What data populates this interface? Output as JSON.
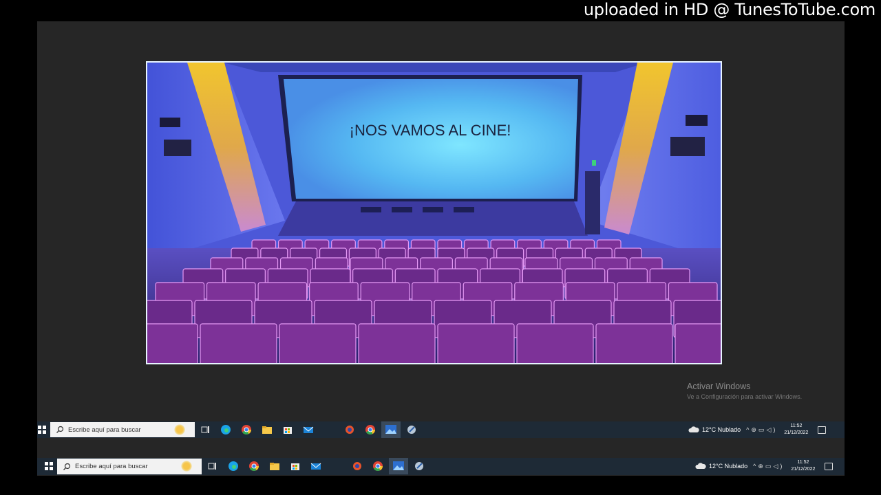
{
  "watermark": "uploaded in HD @ TunesToTube.com",
  "slide": {
    "title": "¡NOS VAMOS AL CINE!"
  },
  "activation": {
    "title": "Activar Windows",
    "subtitle": "Ve a Configuración para activar Windows."
  },
  "taskbar_top": {
    "search_placeholder": "Escribe aquí para buscar",
    "weather": "12°C  Nublado",
    "time": "11:52",
    "date": "21/12/2022"
  },
  "taskbar_bottom": {
    "search_placeholder": "Escribe aquí para buscar",
    "weather": "12°C  Nublado",
    "time": "11:52",
    "date": "21/12/2022"
  },
  "icons": {
    "taskbar_apps": [
      "task-view-icon",
      "edge-icon",
      "chrome-icon",
      "file-explorer-icon",
      "store-icon",
      "mail-icon",
      "app-icon",
      "chrome-profile-icon",
      "photos-icon",
      "snipping-icon"
    ],
    "tray": [
      "cloud-icon",
      "chevron-up-icon",
      "network-icon",
      "volume-icon",
      "notification-icon"
    ]
  },
  "colors": {
    "desktop": "#262626",
    "taskbar": "#1e2a36",
    "screen_blue": "#5fc3f5",
    "seat_magenta": "#b640c8"
  }
}
